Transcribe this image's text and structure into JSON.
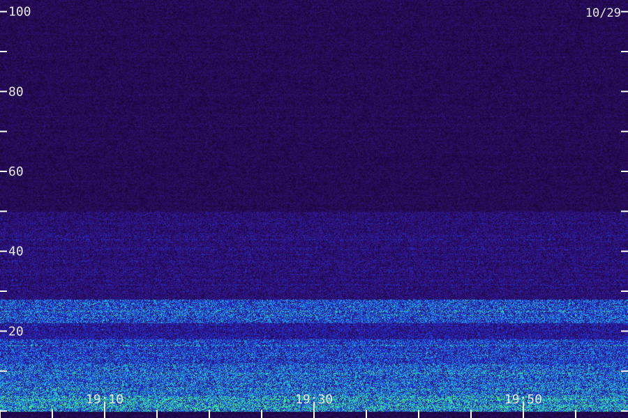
{
  "date_label": "10/29",
  "chart_data": {
    "type": "heatmap",
    "title": "",
    "xlabel": "",
    "ylabel": "",
    "colormap": {
      "background": "#2a0a5a",
      "low": "#3a1a8a",
      "mid": "#2040e0",
      "high": "#20c0e0",
      "peak": "#40ff80"
    },
    "y_axis": {
      "range": [
        0,
        105
      ],
      "major_ticks": [
        0,
        20,
        40,
        60,
        80,
        100
      ],
      "labels": [
        "20",
        "40",
        "60",
        "80",
        "100"
      ],
      "label_values": [
        20,
        40,
        60,
        80,
        100
      ],
      "minor_ticks": [
        10,
        30,
        50,
        70,
        90
      ]
    },
    "x_axis": {
      "range_minutes": [
        0,
        60
      ],
      "labels": [
        "19:10",
        "19:30",
        "19:50"
      ],
      "label_minutes": [
        10,
        30,
        50
      ],
      "major_ticks": [
        10,
        30,
        50
      ],
      "minor_ticks": [
        0,
        5,
        15,
        20,
        25,
        35,
        40,
        45,
        55
      ]
    },
    "bands": [
      {
        "from": 0,
        "to": 4,
        "intensity": 0.85
      },
      {
        "from": 4,
        "to": 12,
        "intensity": 0.7
      },
      {
        "from": 12,
        "to": 18,
        "intensity": 0.6
      },
      {
        "from": 18,
        "to": 22,
        "intensity": 0.4
      },
      {
        "from": 22,
        "to": 28,
        "intensity": 0.65
      },
      {
        "from": 28,
        "to": 50,
        "intensity": 0.3
      },
      {
        "from": 50,
        "to": 105,
        "intensity": 0.18
      }
    ]
  }
}
